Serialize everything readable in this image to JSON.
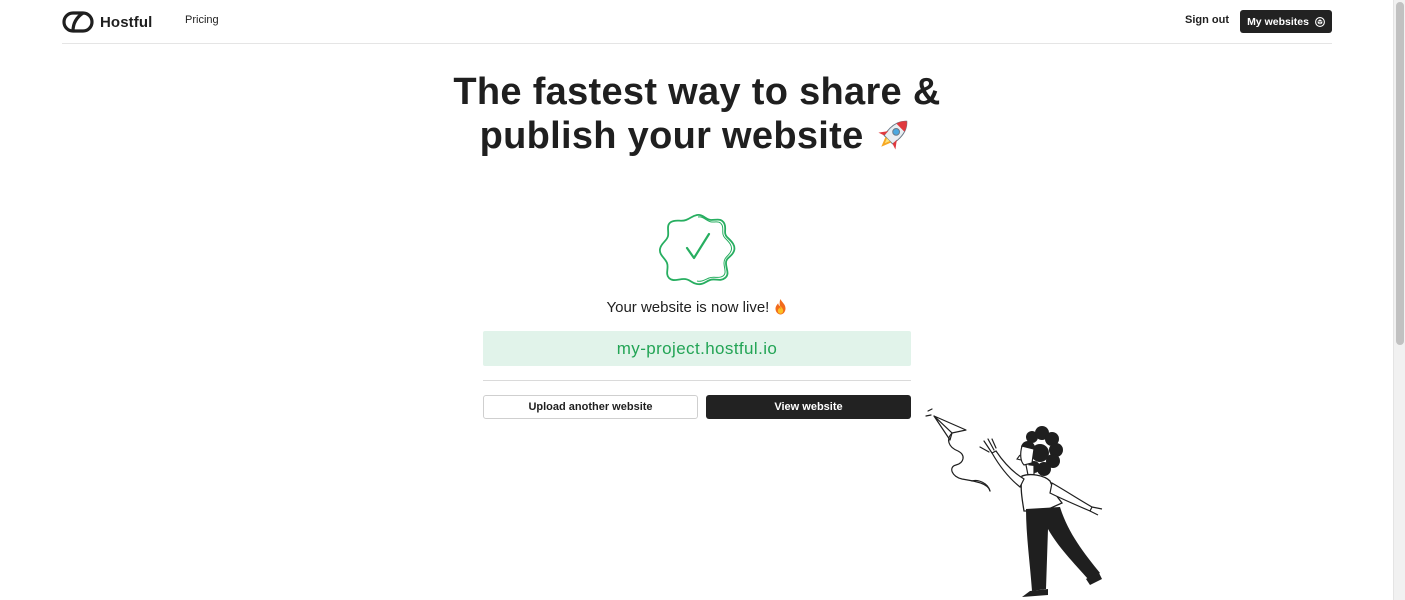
{
  "header": {
    "brand": "Hostful",
    "nav": {
      "pricing": "Pricing"
    },
    "sign_out": "Sign out",
    "my_websites": "My websites"
  },
  "hero": {
    "title_line1": "The fastest way to share &",
    "title_line2": "publish your website"
  },
  "status": {
    "message": "Your website is now live!",
    "url": "my-project.hostful.io"
  },
  "actions": {
    "upload_another": "Upload another website",
    "view_website": "View website"
  },
  "colors": {
    "accent_green": "#22a455",
    "url_background": "#e1f3ea",
    "dark_button": "#222222"
  },
  "icons": [
    "logo-icon",
    "cube-icon",
    "rocket-icon",
    "check-badge-icon",
    "fire-icon",
    "paper-plane-illustration"
  ]
}
